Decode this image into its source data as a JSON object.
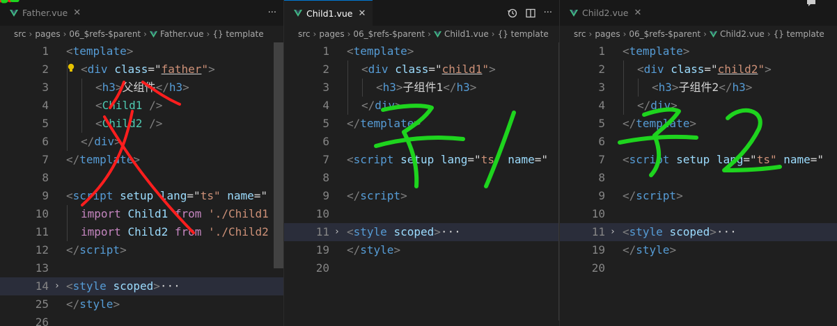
{
  "panes": [
    {
      "tab": "Father.vue",
      "breadcrumb": [
        "src",
        "pages",
        "06_$refs-$parent",
        "Father.vue",
        "{} template"
      ],
      "lines": [
        {
          "n": "1"
        },
        {
          "n": "2"
        },
        {
          "n": "3"
        },
        {
          "n": "4"
        },
        {
          "n": "5"
        },
        {
          "n": "6"
        },
        {
          "n": "7"
        },
        {
          "n": "8"
        },
        {
          "n": "9"
        },
        {
          "n": "10"
        },
        {
          "n": "11"
        },
        {
          "n": "12"
        },
        {
          "n": "13"
        },
        {
          "n": "14"
        },
        {
          "n": "25"
        },
        {
          "n": "26"
        }
      ]
    },
    {
      "tab": "Child1.vue",
      "breadcrumb": [
        "src",
        "pages",
        "06_$refs-$parent",
        "Child1.vue",
        "{} template"
      ],
      "lines": [
        {
          "n": "1"
        },
        {
          "n": "2"
        },
        {
          "n": "3"
        },
        {
          "n": "4"
        },
        {
          "n": "5"
        },
        {
          "n": "6"
        },
        {
          "n": "7"
        },
        {
          "n": "8"
        },
        {
          "n": "9"
        },
        {
          "n": "10"
        },
        {
          "n": "11"
        },
        {
          "n": "19"
        },
        {
          "n": "20"
        }
      ]
    },
    {
      "tab": "Child2.vue",
      "breadcrumb": [
        "src",
        "pages",
        "06_$refs-$parent",
        "Child2.vue",
        "{} template"
      ],
      "lines": [
        {
          "n": "1"
        },
        {
          "n": "2"
        },
        {
          "n": "3"
        },
        {
          "n": "4"
        },
        {
          "n": "5"
        },
        {
          "n": "6"
        },
        {
          "n": "7"
        },
        {
          "n": "8"
        },
        {
          "n": "9"
        },
        {
          "n": "10"
        },
        {
          "n": "11"
        },
        {
          "n": "19"
        },
        {
          "n": "20"
        }
      ]
    }
  ],
  "code": {
    "template_tag": "template",
    "div_tag": "div",
    "class_attr": "class",
    "eq_quote_open": "=\"",
    "quote_close": "\"",
    "father_class": "father",
    "child1_class": "child1",
    "child2_class": "child2",
    "h3_tag": "h3",
    "father_h3_text": "父组件",
    "child1_h3_text": "子组件1",
    "child2_h3_text": "子组件2",
    "child1_comp": "Child1",
    "child2_comp": "Child2",
    "script_tag": "script",
    "setup_attr": "setup",
    "lang_attr": "lang",
    "ts_value": "ts",
    "name_attr": "name",
    "import_kw": "import",
    "from_kw": "from",
    "child1_path": "'./Child1",
    "child2_path": "'./Child2",
    "style_tag": "style",
    "scoped_attr": "scoped",
    "ellipsis": "···"
  },
  "annotations": {
    "father": "父",
    "child1": "子1",
    "child2": "子2",
    "red": "#ff1e1e",
    "green": "#1ed41e"
  },
  "colors": {
    "tag": "#569cd6",
    "attr": "#9cdcfe",
    "string": "#ce9178",
    "keyword": "#c586c0",
    "component": "#4ec9b0",
    "bracket": "#808080"
  }
}
